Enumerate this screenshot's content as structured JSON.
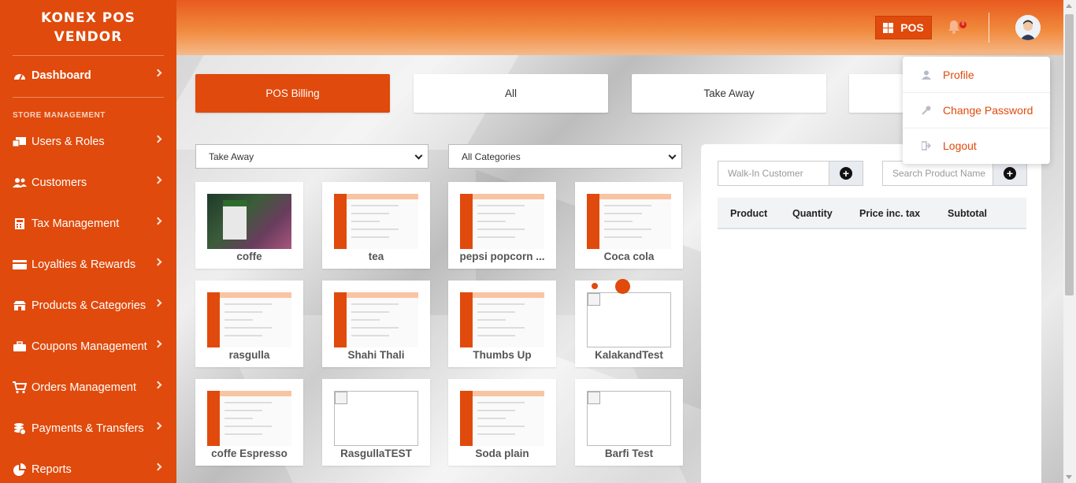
{
  "brand": {
    "line1": "KONEX POS",
    "line2": "VENDOR"
  },
  "sidebar": {
    "dashboard": {
      "label": "Dashboard",
      "icon": "dashboard-icon"
    },
    "section_label": "STORE MANAGEMENT",
    "items": [
      {
        "label": "Users & Roles",
        "icon": "users-roles-icon"
      },
      {
        "label": "Customers",
        "icon": "customers-icon"
      },
      {
        "label": "Tax Management",
        "icon": "calculator-icon"
      },
      {
        "label": "Loyalties & Rewards",
        "icon": "card-icon"
      },
      {
        "label": "Products & Categories",
        "icon": "store-icon"
      },
      {
        "label": "Coupons Management",
        "icon": "briefcase-icon"
      },
      {
        "label": "Orders Management",
        "icon": "cart-icon"
      },
      {
        "label": "Payments & Transfers",
        "icon": "coins-icon"
      },
      {
        "label": "Reports",
        "icon": "pie-chart-icon"
      }
    ]
  },
  "header": {
    "pos_label": "POS",
    "notification_count": "0"
  },
  "tabs": [
    {
      "label": "POS Billing"
    },
    {
      "label": "All"
    },
    {
      "label": "Take Away"
    }
  ],
  "filters": {
    "order_type": "Take Away",
    "category": "All Categories"
  },
  "products": [
    {
      "name": "coffe",
      "image": "photo"
    },
    {
      "name": "tea",
      "image": "screenshot"
    },
    {
      "name": "pepsi popcorn ...",
      "image": "screenshot"
    },
    {
      "name": "Coca cola",
      "image": "screenshot"
    },
    {
      "name": "rasgulla",
      "image": "screenshot"
    },
    {
      "name": "Shahi Thali",
      "image": "screenshot"
    },
    {
      "name": "Thumbs Up",
      "image": "screenshot"
    },
    {
      "name": "KalakandTest",
      "image": "broken"
    },
    {
      "name": "coffe Espresso",
      "image": "screenshot"
    },
    {
      "name": "RasgullaTEST",
      "image": "broken"
    },
    {
      "name": "Soda plain",
      "image": "screenshot"
    },
    {
      "name": "Barfi Test",
      "image": "broken"
    }
  ],
  "cart": {
    "customer_placeholder": "Walk-In Customer",
    "search_placeholder": "Search Product Name",
    "columns": [
      "Product",
      "Quantity",
      "Price inc. tax",
      "Subtotal"
    ]
  },
  "user_menu": {
    "items": [
      {
        "label": "Profile",
        "icon": "user-icon"
      },
      {
        "label": "Change Password",
        "icon": "key-icon"
      },
      {
        "label": "Logout",
        "icon": "logout-icon"
      }
    ]
  },
  "colors": {
    "accent": "#e04a0c"
  }
}
